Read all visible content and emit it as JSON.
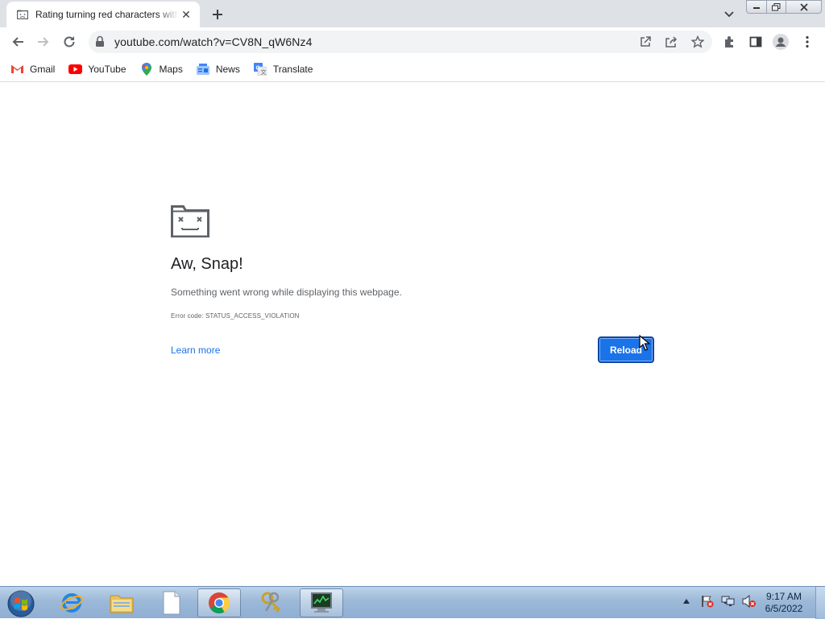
{
  "tab": {
    "title": "Rating turning red characters with",
    "close_label": "✕"
  },
  "toolbar": {
    "url": "youtube.com/watch?v=CV8N_qW6Nz4"
  },
  "bookmarks": [
    {
      "label": "Gmail",
      "icon": "gmail-icon"
    },
    {
      "label": "YouTube",
      "icon": "youtube-icon"
    },
    {
      "label": "Maps",
      "icon": "maps-icon"
    },
    {
      "label": "News",
      "icon": "news-icon"
    },
    {
      "label": "Translate",
      "icon": "translate-icon"
    }
  ],
  "error_page": {
    "title": "Aw, Snap!",
    "message": "Something went wrong while displaying this webpage.",
    "error_code": "Error code: STATUS_ACCESS_VIOLATION",
    "learn_more": "Learn more",
    "reload": "Reload"
  },
  "taskbar": {
    "apps": [
      "start-orb-icon",
      "internet-explorer-icon",
      "file-explorer-icon",
      "notepad-document-icon",
      "chrome-icon",
      "keys-tool-icon",
      "task-manager-icon"
    ],
    "time": "9:17 AM",
    "date": "6/5/2022"
  },
  "colors": {
    "accent": "#1a73e8",
    "tabstrip": "#dee1e6",
    "omnibox": "#f1f3f4",
    "taskbar": "#9db9d8"
  }
}
